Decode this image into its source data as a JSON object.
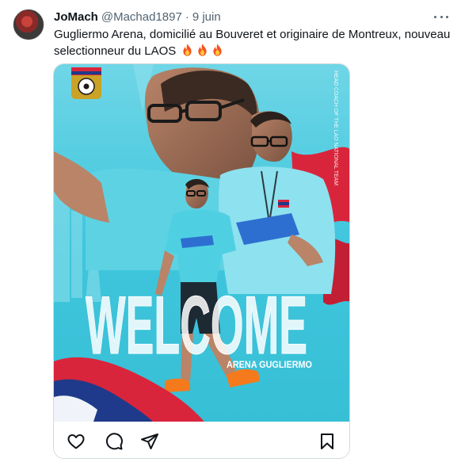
{
  "tweet": {
    "author_name": "JoMach",
    "author_handle": "@Machad1897",
    "separator": "·",
    "date": "9 juin",
    "text": "Gugliermo Arena, domicilié au Bouveret et originaire de Montreux, nouveau selectionneur du LAOS",
    "emoji_count": 3,
    "emoji": "fire-emoji"
  },
  "poster": {
    "headline": "WELCOME",
    "subtitle": "ARENA GUGLIERMO",
    "side_text": "HEAD COACH OF THE LAO NATIONAL TEAM",
    "colors": {
      "background": "#3fc6dd",
      "accent_red": "#d9253b",
      "flag_blue": "#1f3a8a"
    }
  },
  "actions": {
    "icons": [
      "heart-icon",
      "comment-icon",
      "share-icon",
      "bookmark-icon"
    ]
  },
  "colors": {
    "text": "#0f1419",
    "secondary": "#536471",
    "border": "#cfd9de"
  }
}
